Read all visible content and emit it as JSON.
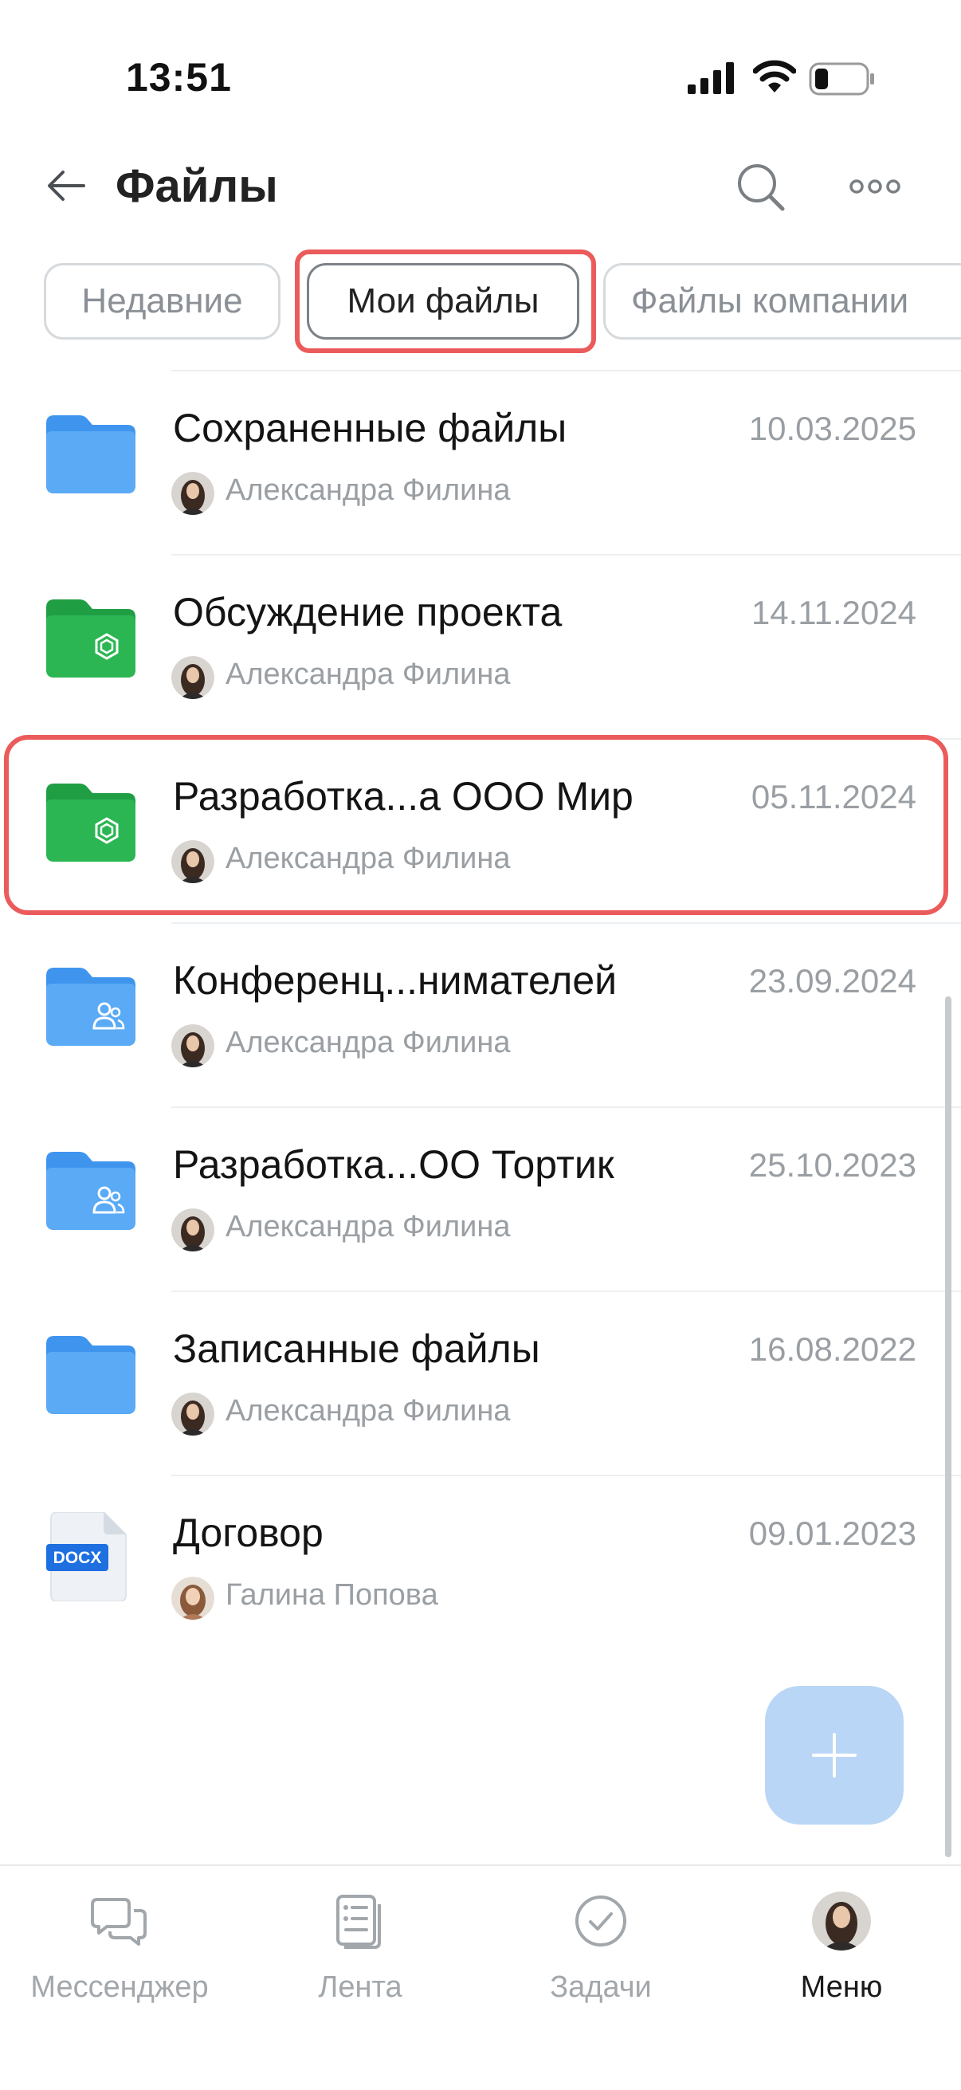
{
  "status_bar": {
    "time": "13:51"
  },
  "header": {
    "title": "Файлы"
  },
  "tabs": [
    {
      "label": "Недавние"
    },
    {
      "label": "Мои файлы",
      "selected": true
    },
    {
      "label": "Файлы компании"
    }
  ],
  "files": [
    {
      "name": "Сохраненные файлы",
      "date": "10.03.2025",
      "owner": "Александра Филина",
      "icon": "folder-blue"
    },
    {
      "name": "Обсуждение проекта",
      "date": "14.11.2024",
      "owner": "Александра Филина",
      "icon": "folder-green-group"
    },
    {
      "name": "Разработка...а ООО Мир",
      "date": "05.11.2024",
      "owner": "Александра Филина",
      "icon": "folder-green-group"
    },
    {
      "name": "Конференц...нимателей",
      "date": "23.09.2024",
      "owner": "Александра Филина",
      "icon": "folder-shared"
    },
    {
      "name": "Разработка...ОО Тортик",
      "date": "25.10.2023",
      "owner": "Александра Филина",
      "icon": "folder-shared"
    },
    {
      "name": "Записанные файлы",
      "date": "16.08.2022",
      "owner": "Александра Филина",
      "icon": "folder-blue"
    },
    {
      "name": "Договор",
      "date": "09.01.2023",
      "owner": "Галина Попова",
      "icon": "docx-file",
      "badge": "DOCX"
    }
  ],
  "bottom_nav": [
    {
      "label": "Мессенджер",
      "icon": "chat-icon"
    },
    {
      "label": "Лента",
      "icon": "feed-icon"
    },
    {
      "label": "Задачи",
      "icon": "tasks-icon"
    },
    {
      "label": "Меню",
      "icon": "avatar",
      "active": true
    }
  ],
  "colors": {
    "highlight": "#ec5b5b",
    "folder_blue": "#4a9ff0",
    "folder_green": "#27b24f",
    "fab": "#b9d6f6"
  }
}
